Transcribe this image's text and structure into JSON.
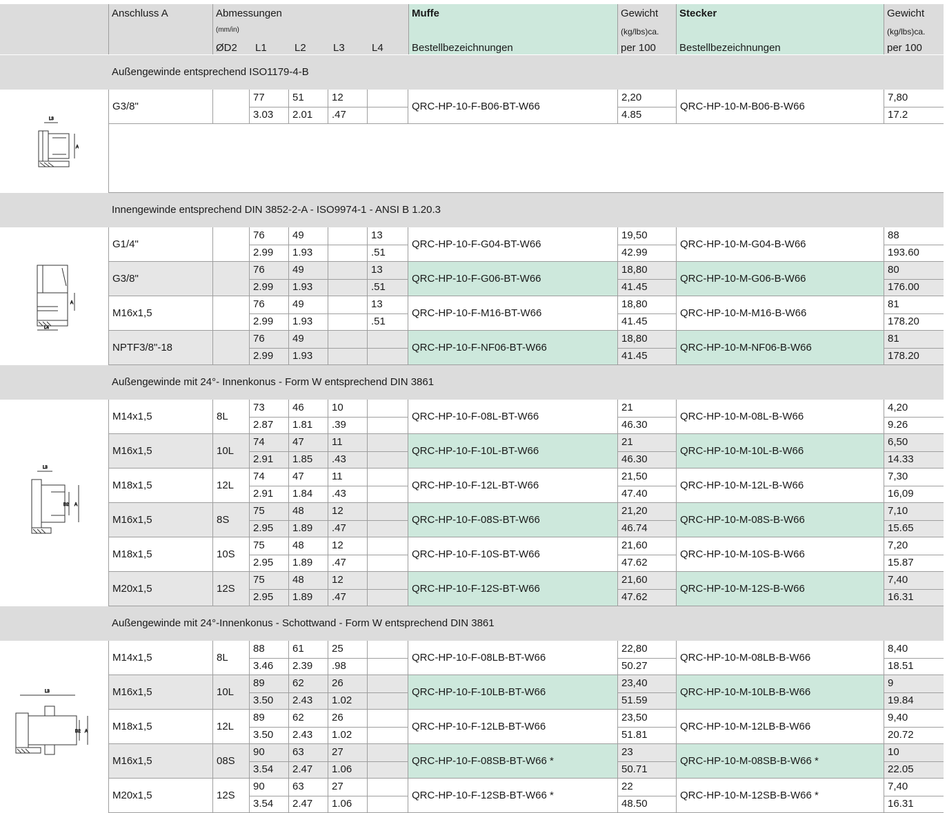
{
  "header": {
    "anschluss": "Anschluss A",
    "abmessungen": "Abmessungen",
    "abm_unit": "(mm/in)",
    "d2": "ØD2",
    "l1": "L1",
    "l2": "L2",
    "l3": "L3",
    "l4": "L4",
    "muffe": "Muffe",
    "bestell1": "Bestellbezeichnungen",
    "gewicht1": "Gewicht",
    "gewicht_unit1": "(kg/lbs)ca.",
    "per1": "per 100",
    "stecker": "Stecker",
    "bestell2": "Bestellbezeichnungen",
    "gewicht2": "Gewicht",
    "gewicht_unit2": "(kg/lbs)ca.",
    "per2": "per 100"
  },
  "colors": {
    "header_gray": "#dcdcdc",
    "row_gray": "#e6e6e6",
    "green": "#cde8dc",
    "line": "#9e9e9e"
  },
  "sections": [
    {
      "title": "Außengewinde entsprechend ISO1179-4-B",
      "drawing_icon": "fitting-external-thread-icon",
      "rows": [
        {
          "a": "G3/8\"",
          "d2": "",
          "l1": [
            "77",
            "3.03"
          ],
          "l2": [
            "51",
            "2.01"
          ],
          "l3": [
            "12",
            ".47"
          ],
          "l4": [
            "",
            ""
          ],
          "muffe": "QRC-HP-10-F-B06-BT-W66",
          "gm": [
            "2,20",
            "4.85"
          ],
          "stecker": "QRC-HP-10-M-B06-B-W66",
          "gs": [
            "7,80",
            "17.2"
          ],
          "shade": false
        }
      ]
    },
    {
      "title": "Innengewinde entsprechend  DIN 3852-2-A  - ISO9974-1  - ANSI B  1.20.3",
      "drawing_icon": "fitting-internal-thread-icon",
      "rows": [
        {
          "a": "G1/4\"",
          "d2": "",
          "l1": [
            "76",
            "2.99"
          ],
          "l2": [
            "49",
            "1.93"
          ],
          "l3": [
            "",
            ""
          ],
          "l4": [
            "13",
            ".51"
          ],
          "muffe": "QRC-HP-10-F-G04-BT-W66",
          "gm": [
            "19,50",
            "42.99"
          ],
          "stecker": "QRC-HP-10-M-G04-B-W66",
          "gs": [
            "88",
            "193.60"
          ],
          "shade": false
        },
        {
          "a": "G3/8\"",
          "d2": "",
          "l1": [
            "76",
            "2.99"
          ],
          "l2": [
            "49",
            "1.93"
          ],
          "l3": [
            "",
            ""
          ],
          "l4": [
            "13",
            ".51"
          ],
          "muffe": "QRC-HP-10-F-G06-BT-W66",
          "gm": [
            "18,80",
            "41.45"
          ],
          "stecker": "QRC-HP-10-M-G06-B-W66",
          "gs": [
            "80",
            "176.00"
          ],
          "shade": true
        },
        {
          "a": "M16x1,5",
          "d2": "",
          "l1": [
            "76",
            "2.99"
          ],
          "l2": [
            "49",
            "1.93"
          ],
          "l3": [
            "",
            ""
          ],
          "l4": [
            "13",
            ".51"
          ],
          "muffe": "QRC-HP-10-F-M16-BT-W66",
          "gm": [
            "18,80",
            "41.45"
          ],
          "stecker": "QRC-HP-10-M-M16-B-W66",
          "gs": [
            "81",
            "178.20"
          ],
          "shade": false
        },
        {
          "a": "NPTF3/8\"-18",
          "d2": "",
          "l1": [
            "76",
            "2.99"
          ],
          "l2": [
            "49",
            "1.93"
          ],
          "l3": [
            "",
            ""
          ],
          "l4": [
            "",
            ""
          ],
          "muffe": "QRC-HP-10-F-NF06-BT-W66",
          "gm": [
            "18,80",
            "41.45"
          ],
          "stecker": "QRC-HP-10-M-NF06-B-W66",
          "gs": [
            "81",
            "178.20"
          ],
          "shade": true
        }
      ]
    },
    {
      "title": "Außengewinde mit 24°- Innenkonus - Form W entsprechend DIN 3861",
      "drawing_icon": "fitting-24deg-cone-icon",
      "rows": [
        {
          "a": "M14x1,5",
          "d2": "8L",
          "l1": [
            "73",
            "2.87"
          ],
          "l2": [
            "46",
            "1.81"
          ],
          "l3": [
            "10",
            ".39"
          ],
          "l4": [
            "",
            ""
          ],
          "muffe": "QRC-HP-10-F-08L-BT-W66",
          "gm": [
            "21",
            "46.30"
          ],
          "stecker": "QRC-HP-10-M-08L-B-W66",
          "gs": [
            "4,20",
            "9.26"
          ],
          "shade": false
        },
        {
          "a": "M16x1,5",
          "d2": "10L",
          "l1": [
            "74",
            "2.91"
          ],
          "l2": [
            "47",
            "1.85"
          ],
          "l3": [
            "11",
            ".43"
          ],
          "l4": [
            "",
            ""
          ],
          "muffe": "QRC-HP-10-F-10L-BT-W66",
          "gm": [
            "21",
            "46.30"
          ],
          "stecker": "QRC-HP-10-M-10L-B-W66",
          "gs": [
            "6,50",
            "14.33"
          ],
          "shade": true
        },
        {
          "a": "M18x1,5",
          "d2": "12L",
          "l1": [
            "74",
            "2.91"
          ],
          "l2": [
            "47",
            "1.84"
          ],
          "l3": [
            "11",
            ".43"
          ],
          "l4": [
            "",
            ""
          ],
          "muffe": "QRC-HP-10-F-12L-BT-W66",
          "gm": [
            "21,50",
            "47.40"
          ],
          "stecker": "QRC-HP-10-M-12L-B-W66",
          "gs": [
            "7,30",
            "16,09"
          ],
          "shade": false
        },
        {
          "a": "M16x1,5",
          "d2": "8S",
          "l1": [
            "75",
            "2.95"
          ],
          "l2": [
            "48",
            "1.89"
          ],
          "l3": [
            "12",
            ".47"
          ],
          "l4": [
            "",
            ""
          ],
          "muffe": "QRC-HP-10-F-08S-BT-W66",
          "gm": [
            "21,20",
            "46.74"
          ],
          "stecker": "QRC-HP-10-M-08S-B-W66",
          "gs": [
            "7,10",
            "15.65"
          ],
          "shade": true
        },
        {
          "a": "M18x1,5",
          "d2": "10S",
          "l1": [
            "75",
            "2.95"
          ],
          "l2": [
            "48",
            "1.89"
          ],
          "l3": [
            "12",
            ".47"
          ],
          "l4": [
            "",
            ""
          ],
          "muffe": "QRC-HP-10-F-10S-BT-W66",
          "gm": [
            "21,60",
            "47.62"
          ],
          "stecker": "QRC-HP-10-M-10S-B-W66",
          "gs": [
            "7,20",
            "15.87"
          ],
          "shade": false
        },
        {
          "a": "M20x1,5",
          "d2": "12S",
          "l1": [
            "75",
            "2.95"
          ],
          "l2": [
            "48",
            "1.89"
          ],
          "l3": [
            "12",
            ".47"
          ],
          "l4": [
            "",
            ""
          ],
          "muffe": "QRC-HP-10-F-12S-BT-W66",
          "gm": [
            "21,60",
            "47.62"
          ],
          "stecker": "QRC-HP-10-M-12S-B-W66",
          "gs": [
            "7,40",
            "16.31"
          ],
          "shade": true
        }
      ]
    },
    {
      "title": "Außengewinde mit 24°-Innenkonus - Schottwand -  Form W entsprechend DIN 3861",
      "drawing_icon": "fitting-bulkhead-icon",
      "rows": [
        {
          "a": "M14x1,5",
          "d2": "8L",
          "l1": [
            "88",
            "3.46"
          ],
          "l2": [
            "61",
            "2.39"
          ],
          "l3": [
            "25",
            ".98"
          ],
          "l4": [
            "",
            ""
          ],
          "muffe": "QRC-HP-10-F-08LB-BT-W66",
          "gm": [
            "22,80",
            "50.27"
          ],
          "stecker": "QRC-HP-10-M-08LB-B-W66",
          "gs": [
            "8,40",
            "18.51"
          ],
          "shade": false
        },
        {
          "a": "M16x1,5",
          "d2": "10L",
          "l1": [
            "89",
            "3.50"
          ],
          "l2": [
            "62",
            "2.43"
          ],
          "l3": [
            "26",
            "1.02"
          ],
          "l4": [
            "",
            ""
          ],
          "muffe": "QRC-HP-10-F-10LB-BT-W66",
          "gm": [
            "23,40",
            "51.59"
          ],
          "stecker": "QRC-HP-10-M-10LB-B-W66",
          "gs": [
            "9",
            "19.84"
          ],
          "shade": true
        },
        {
          "a": "M18x1,5",
          "d2": "12L",
          "l1": [
            "89",
            "3.50"
          ],
          "l2": [
            "62",
            "2.43"
          ],
          "l3": [
            "26",
            "1.02"
          ],
          "l4": [
            "",
            ""
          ],
          "muffe": "QRC-HP-10-F-12LB-BT-W66",
          "gm": [
            "23,50",
            "51.81"
          ],
          "stecker": "QRC-HP-10-M-12LB-B-W66",
          "gs": [
            "9,40",
            "20.72"
          ],
          "shade": false
        },
        {
          "a": "M16x1,5",
          "d2": "08S",
          "l1": [
            "90",
            "3.54"
          ],
          "l2": [
            "63",
            "2.47"
          ],
          "l3": [
            "27",
            "1.06"
          ],
          "l4": [
            "",
            ""
          ],
          "muffe": "QRC-HP-10-F-08SB-BT-W66 *",
          "gm": [
            "23",
            "50.71"
          ],
          "stecker": "QRC-HP-10-M-08SB-B-W66 *",
          "gs": [
            "10",
            "22.05"
          ],
          "shade": true
        },
        {
          "a": "M20x1,5",
          "d2": "12S",
          "l1": [
            "90",
            "3.54"
          ],
          "l2": [
            "63",
            "2.47"
          ],
          "l3": [
            "27",
            "1.06"
          ],
          "l4": [
            "",
            ""
          ],
          "muffe": "QRC-HP-10-F-12SB-BT-W66 *",
          "gm": [
            "22",
            "48.50"
          ],
          "stecker": "QRC-HP-10-M-12SB-B-W66 *",
          "gs": [
            "7,40",
            "16.31"
          ],
          "shade": false
        }
      ]
    }
  ]
}
